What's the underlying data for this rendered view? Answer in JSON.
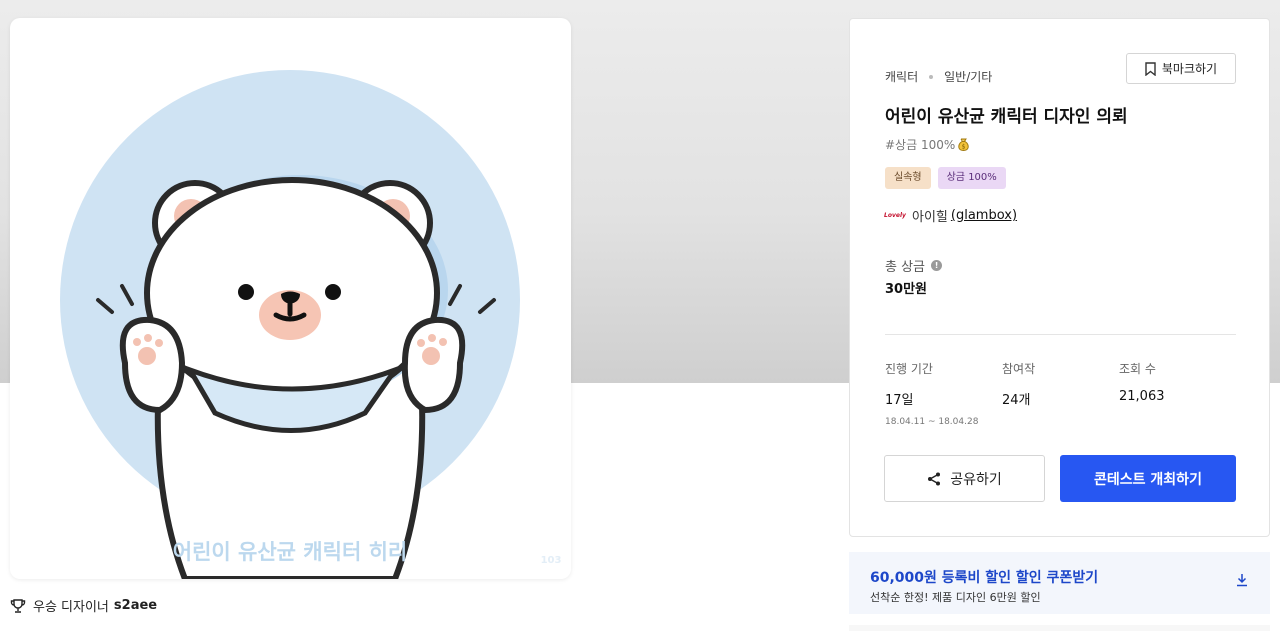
{
  "artwork": {
    "caption": "어린이 유산균 캐릭터 히리",
    "watermark": "103"
  },
  "winner": {
    "label": "우승 디자이너",
    "name": "s2aee"
  },
  "contest": {
    "category": "캐릭터",
    "subcategory": "일반/기타",
    "bookmark_label": "북마크하기",
    "title": "어린이 유산균 캐릭터 디자인 의뢰",
    "hashtag": "#상금 100%",
    "tags": [
      "실속형",
      "상금 100%"
    ],
    "host_logo_text": "Lovely",
    "host_name": "아이힐",
    "host_handle": "(glambox)",
    "prize_label": "총 상금",
    "prize_value": "30만원",
    "stats": {
      "period_label": "진행 기간",
      "period_value": "17일",
      "period_dates": "18.04.11 ~ 18.04.28",
      "entries_label": "참여작",
      "entries_value": "24개",
      "views_label": "조회 수",
      "views_value": "21,063"
    },
    "share_label": "공유하기",
    "host_contest_label": "콘테스트 개최하기"
  },
  "coupon": {
    "title": "60,000원 등록비 할인 할인 쿠폰받기",
    "subtitle": "선착순 한정! 제품 디자인 6만원 할인"
  },
  "colors": {
    "primary": "#2757f2",
    "coupon_text": "#1d47c9",
    "artwork_circle": "#cfe3f3"
  }
}
